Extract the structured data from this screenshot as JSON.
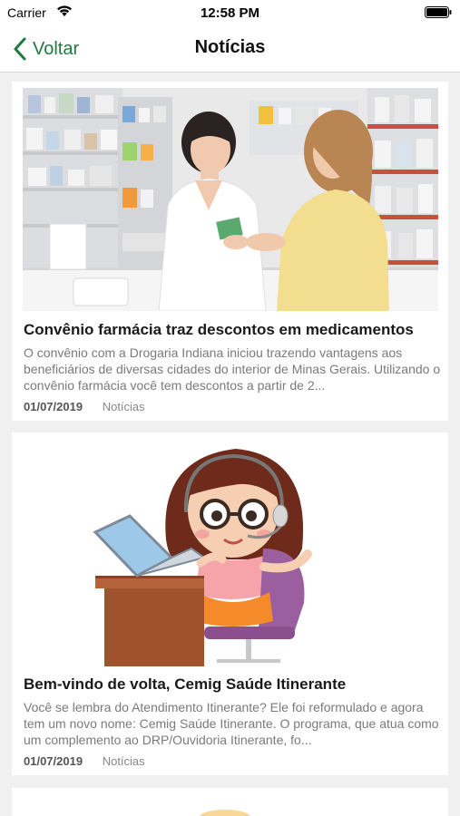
{
  "status_bar": {
    "carrier": "Carrier",
    "time": "12:58 PM",
    "icons": [
      "wifi-icon",
      "battery-icon"
    ]
  },
  "nav": {
    "back_label": "Voltar",
    "title": "Notícias",
    "accent_color": "#1f7a3d"
  },
  "news": [
    {
      "image": "pharmacist-and-customer-photo",
      "title": "Convênio farmácia traz descontos em medicamentos",
      "excerpt": "O convênio com a Drogaria Indiana iniciou trazendo vantagens aos beneficiários de diversas cidades do interior de Minas Gerais. Utilizando o convênio farmácia você tem descontos a partir de 2...",
      "date": "01/07/2019",
      "category": "Notícias"
    },
    {
      "image": "cartoon-call-center-attendant-illustration",
      "title": "Bem-vindo de volta, Cemig Saúde Itinerante",
      "excerpt": "Você se lembra do Atendimento Itinerante? Ele foi reformulado e agora tem um novo nome: Cemig Saúde Itinerante. O programa, que atua como um complemento ao DRP/Ouvidoria Itinerante, fo...",
      "date": "01/07/2019",
      "category": "Notícias"
    }
  ]
}
